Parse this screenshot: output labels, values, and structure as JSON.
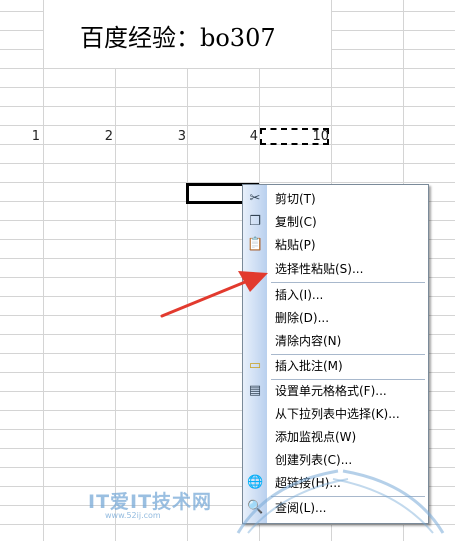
{
  "sheet": {
    "title": "百度经验：bo307",
    "row_values": [
      "1",
      "2",
      "3",
      "4",
      "10"
    ]
  },
  "context_menu": {
    "items": [
      {
        "label": "剪切(T)",
        "icon": "scissors-icon",
        "glyph": "✂"
      },
      {
        "label": "复制(C)",
        "icon": "copy-icon",
        "glyph": "❐"
      },
      {
        "label": "粘贴(P)",
        "icon": "paste-icon",
        "glyph": "📋"
      },
      {
        "label": "选择性粘贴(S)...",
        "icon": "",
        "glyph": ""
      },
      {
        "label": "插入(I)...",
        "icon": "",
        "glyph": ""
      },
      {
        "label": "删除(D)...",
        "icon": "",
        "glyph": ""
      },
      {
        "label": "清除内容(N)",
        "icon": "",
        "glyph": ""
      },
      {
        "label": "插入批注(M)",
        "icon": "comment-icon",
        "glyph": "▭"
      },
      {
        "label": "设置单元格格式(F)...",
        "icon": "format-cells-icon",
        "glyph": "▤"
      },
      {
        "label": "从下拉列表中选择(K)...",
        "icon": "",
        "glyph": ""
      },
      {
        "label": "添加监视点(W)",
        "icon": "",
        "glyph": ""
      },
      {
        "label": "创建列表(C)...",
        "icon": "",
        "glyph": ""
      },
      {
        "label": "超链接(H)...",
        "icon": "hyperlink-icon",
        "glyph": "🌐"
      },
      {
        "label": "查阅(L)...",
        "icon": "research-icon",
        "glyph": "🔍"
      }
    ]
  },
  "watermark": {
    "text": "IT爱IT技术网",
    "sub": "www.52ij.com"
  },
  "colors": {
    "arrow": "#e23a2e",
    "menu_gutter": "#b9d0ee"
  }
}
